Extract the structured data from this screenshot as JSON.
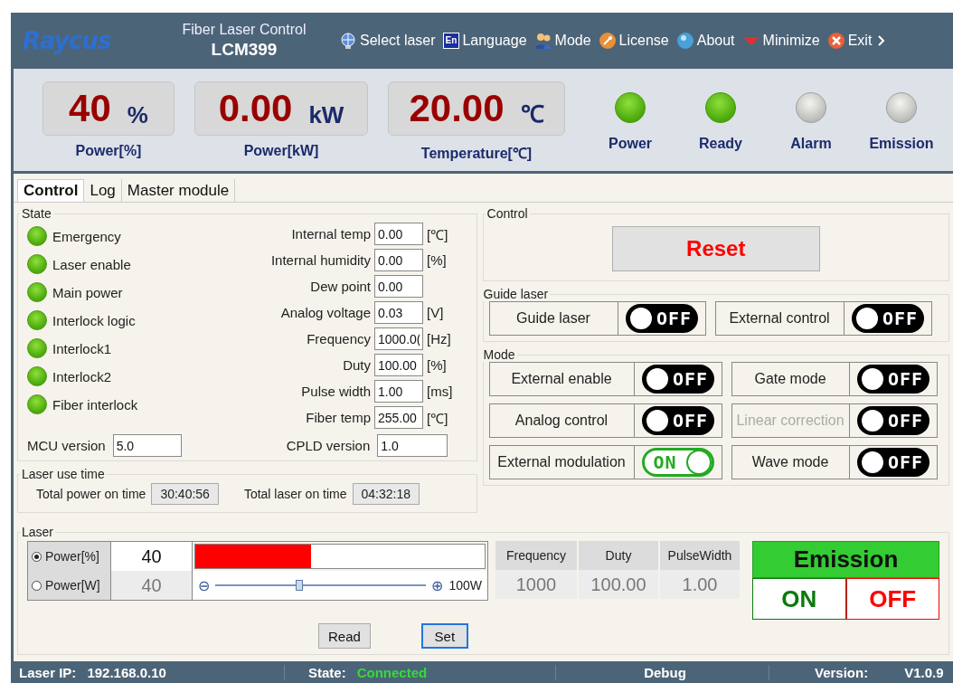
{
  "header": {
    "logo": "Raycus",
    "title": "Fiber Laser Control",
    "model": "LCM399",
    "menu": [
      {
        "kind": "globe",
        "label": "Select laser"
      },
      {
        "kind": "lang",
        "label": "Language",
        "badge": "En"
      },
      {
        "kind": "users",
        "label": "Mode"
      },
      {
        "kind": "key",
        "label": "License"
      },
      {
        "kind": "info",
        "label": "About"
      },
      {
        "kind": "minimize",
        "label": "Minimize"
      },
      {
        "kind": "exit",
        "label": "Exit"
      }
    ]
  },
  "readouts": [
    {
      "value": "40",
      "unit": "%",
      "label": "Power[%]"
    },
    {
      "value": "0.00",
      "unit": "kW",
      "label": "Power[kW]"
    },
    {
      "value": "20.00",
      "unit": "℃",
      "label": "Temperature[℃]"
    }
  ],
  "indicators": [
    {
      "label": "Power",
      "on": true
    },
    {
      "label": "Ready",
      "on": true
    },
    {
      "label": "Alarm",
      "on": false
    },
    {
      "label": "Emission",
      "on": false
    }
  ],
  "tabs": [
    {
      "label": "Control",
      "selected": true
    },
    {
      "label": "Log",
      "selected": false
    },
    {
      "label": "Master module",
      "selected": false
    }
  ],
  "state": {
    "title": "State",
    "leds": [
      {
        "label": "Emergency",
        "on": true
      },
      {
        "label": "Laser enable",
        "on": true
      },
      {
        "label": "Main power",
        "on": true
      },
      {
        "label": "Interlock logic",
        "on": true
      },
      {
        "label": "Interlock1",
        "on": true
      },
      {
        "label": "Interlock2",
        "on": true
      },
      {
        "label": "Fiber interlock",
        "on": true
      }
    ],
    "fields": [
      {
        "label": "Internal temp",
        "value": "0.00",
        "unit": "[℃]"
      },
      {
        "label": "Internal humidity",
        "value": "0.00",
        "unit": "[%]"
      },
      {
        "label": "Dew point",
        "value": "0.00"
      },
      {
        "label": "Analog voltage",
        "value": "0.03",
        "unit": "[V]"
      },
      {
        "label": "Frequency",
        "value": "1000.0(",
        "unit": "[Hz]"
      },
      {
        "label": "Duty",
        "value": "100.00",
        "unit": "[%]"
      },
      {
        "label": "Pulse width",
        "value": "1.00",
        "unit": "[ms]"
      },
      {
        "label": "Fiber temp",
        "value": "255.00",
        "unit": "[℃]"
      }
    ],
    "mcu_version": {
      "label": "MCU version",
      "value": "5.0"
    },
    "cpld_version": {
      "label": "CPLD version",
      "value": "1.0"
    }
  },
  "laser_use_time": {
    "title": "Laser use time",
    "items": [
      {
        "label": "Total power on time",
        "value": "30:40:56"
      },
      {
        "label": "Total laser on time",
        "value": "04:32:18"
      }
    ]
  },
  "control": {
    "title": "Control",
    "reset": "Reset"
  },
  "guide_laser": {
    "title": "Guide laser",
    "switches": [
      {
        "label": "Guide laser",
        "on": false,
        "disabled": false,
        "text": "OFF"
      },
      {
        "label": "External control",
        "on": false,
        "disabled": false,
        "text": "OFF"
      }
    ]
  },
  "mode": {
    "title": "Mode",
    "switches": [
      {
        "label": "External enable",
        "on": false,
        "disabled": false,
        "text": "OFF"
      },
      {
        "label": "Gate mode",
        "on": false,
        "disabled": false,
        "text": "OFF"
      },
      {
        "label": "Analog control",
        "on": false,
        "disabled": false,
        "text": "OFF"
      },
      {
        "label": "Linear correction",
        "on": false,
        "disabled": true,
        "text": "OFF"
      },
      {
        "label": "External modulation",
        "on": true,
        "disabled": false,
        "text": "ON"
      },
      {
        "label": "Wave mode",
        "on": false,
        "disabled": false,
        "text": "OFF"
      }
    ]
  },
  "laser": {
    "title": "Laser",
    "options": [
      {
        "label": "Power[%]",
        "selected": true,
        "value": "40"
      },
      {
        "label": "Power[W]",
        "selected": false,
        "value": "40"
      }
    ],
    "power_bar": {
      "level": 0.4
    },
    "slider": {
      "level": 0.4,
      "minus": "⊖",
      "plus": "⊕",
      "max": "100W"
    },
    "params": [
      {
        "label": "Frequency",
        "value": "1000"
      },
      {
        "label": "Duty",
        "value": "100.00"
      },
      {
        "label": "PulseWidth",
        "value": "1.00"
      }
    ],
    "read": {
      "label": "Read",
      "focused": false
    },
    "set": {
      "label": "Set",
      "focused": true
    },
    "emission": {
      "title": "Emission",
      "on": "ON",
      "off": "OFF"
    }
  },
  "status_bar": {
    "ip_label": "Laser IP:",
    "ip": "192.168.0.10",
    "state_label": "State:",
    "state": "Connected",
    "debug": "Debug",
    "version_label": "Version:",
    "version": "V1.0.9"
  }
}
